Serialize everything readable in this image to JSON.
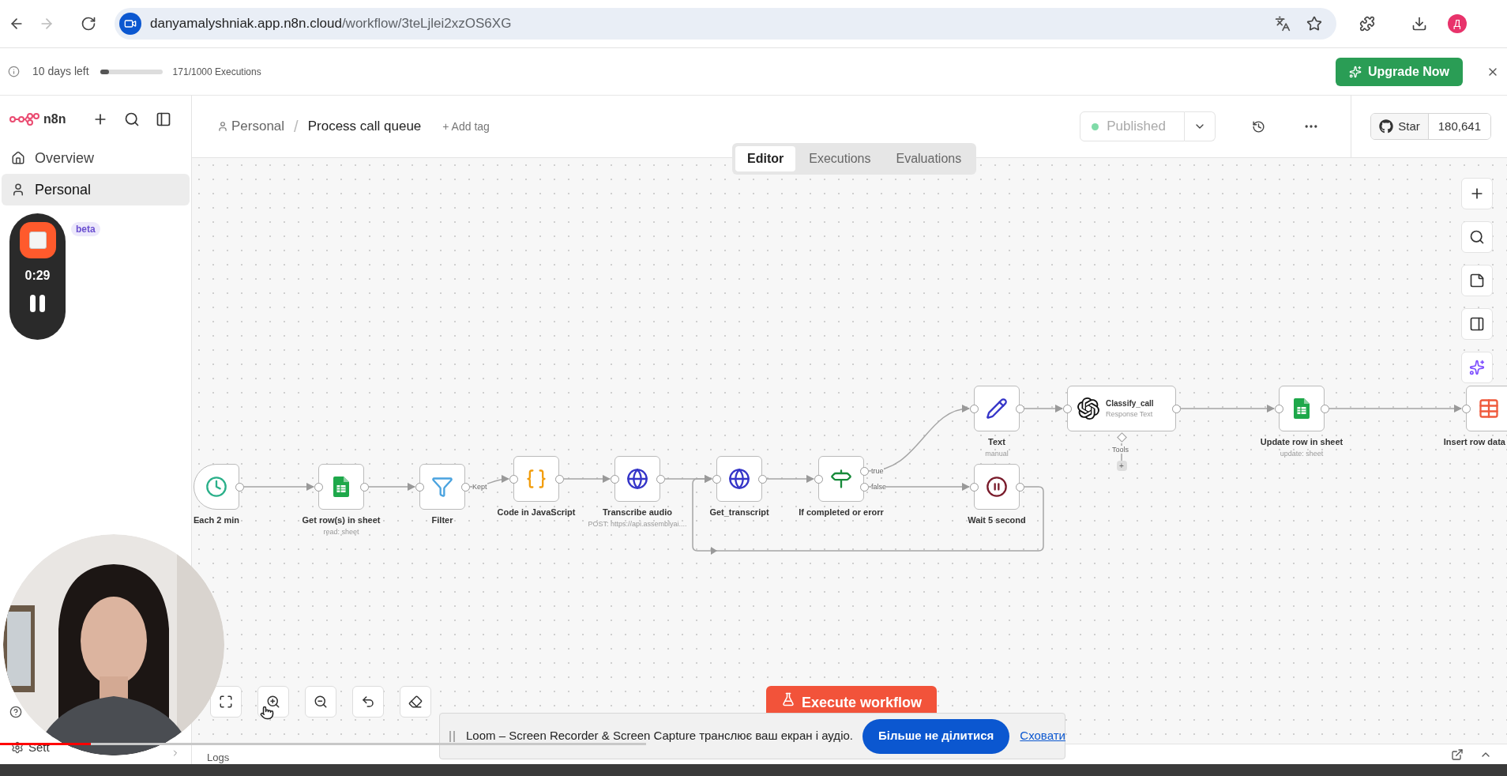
{
  "browser": {
    "back_disabled": false,
    "forward_disabled": true,
    "url_host": "danyamalyshniak.app.n8n.cloud",
    "url_path": "/workflow/3teLjlei2xzOS6XG",
    "avatar": "Д"
  },
  "trial_banner": {
    "days_left": "10 days left",
    "level": 0.15,
    "executions": "171/1000 Executions",
    "upgrade": "Upgrade Now"
  },
  "sidebar": {
    "logo": "n8n",
    "items": [
      {
        "label": "Overview",
        "selected": false
      },
      {
        "label": "Personal",
        "selected": true
      }
    ],
    "beta_badge": "beta",
    "settings": "Sett"
  },
  "recorder": {
    "time": "0:29"
  },
  "header": {
    "breadcrumb": "Personal",
    "separator": "/",
    "title": "Process call queue",
    "add_tag": "+ Add tag",
    "publish": "Published",
    "github": "Star",
    "stars": "180,641"
  },
  "tabs": [
    {
      "label": "Editor",
      "selected": true
    },
    {
      "label": "Executions",
      "selected": false
    },
    {
      "label": "Evaluations",
      "selected": false
    }
  ],
  "nodes": [
    {
      "kind": "trigger",
      "name": "Each 2 min"
    },
    {
      "kind": "node",
      "name": "Get row(s) in sheet",
      "subtitle": "read: sheet"
    },
    {
      "kind": "node",
      "name": "Filter"
    },
    {
      "kind": "node",
      "name": "Code in JavaScript"
    },
    {
      "kind": "node",
      "name": "Transcribe audio",
      "subtitle": "POST: https://api.assemblyai...."
    },
    {
      "kind": "node",
      "name": "Get_transcript"
    },
    {
      "kind": "node",
      "name": "If completed or erorr"
    },
    {
      "kind": "node",
      "name": "Text",
      "subtitle": "manual"
    },
    {
      "kind": "node",
      "name": "Wait 5 second"
    },
    {
      "kind": "agent",
      "name": "Classify_call",
      "subtitle": "Response Text"
    },
    {
      "kind": "node",
      "name": "Update row in sheet",
      "subtitle": "update: sheet"
    },
    {
      "kind": "node",
      "name": "Insert row data"
    }
  ],
  "edge_labels": [
    "Kept",
    "true",
    "false",
    "Tools"
  ],
  "add_tool": "+",
  "execute_button": "Execute workflow",
  "share_banner": {
    "message": "Loom – Screen Recorder & Screen Capture транслює ваш екран і аудіо.",
    "stop": "Більше не ділитися",
    "hide": "Сховати"
  },
  "logs": "Logs",
  "video": {
    "level": 0.14
  }
}
